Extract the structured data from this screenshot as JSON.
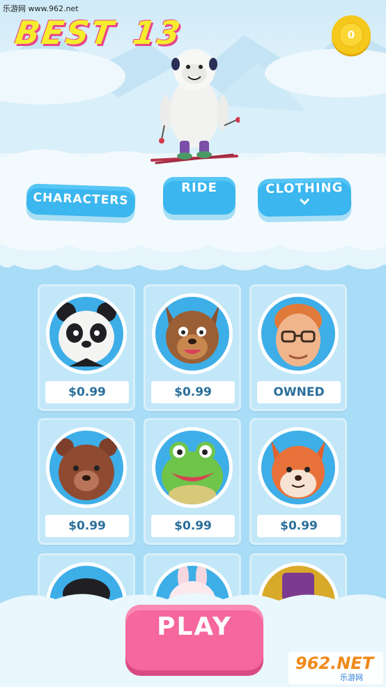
{
  "site_label": "乐游网 www.962.net",
  "header": {
    "best_label": "BEST",
    "best_score": "13",
    "coins": "0"
  },
  "menu": {
    "characters_label": "CHARACTERS",
    "ride_label": "RIDE",
    "clothing_label": "CLOTHING"
  },
  "characters": [
    {
      "name": "panda",
      "price": "$0.99"
    },
    {
      "name": "werewolf",
      "price": "$0.99"
    },
    {
      "name": "red-haired-man",
      "price": "OWNED"
    },
    {
      "name": "bear",
      "price": "$0.99"
    },
    {
      "name": "frog",
      "price": "$0.99"
    },
    {
      "name": "fox",
      "price": "$0.99"
    }
  ],
  "play_label": "PLAY",
  "watermark": {
    "main": "962.NET",
    "sub": "乐游网"
  },
  "colors": {
    "accent_blue": "#3bb6ee",
    "play_pink": "#f5679d",
    "coin_gold": "#f5c81c",
    "title_yellow": "#f7ec2c"
  }
}
